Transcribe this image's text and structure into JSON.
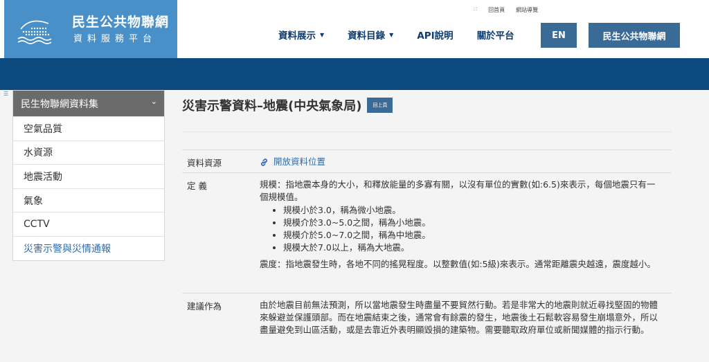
{
  "logo": {
    "title": "民生公共物聯網",
    "subtitle": "資料服務平台"
  },
  "util_nav": {
    "icon": "sitemap-dots-icon",
    "home": "回首頁",
    "sitemap": "網站導覽"
  },
  "main_nav": [
    {
      "label": "資料展示",
      "has_dropdown": true
    },
    {
      "label": "資料目錄",
      "has_dropdown": true
    },
    {
      "label": "API說明",
      "has_dropdown": false
    },
    {
      "label": "關於平台",
      "has_dropdown": false
    }
  ],
  "buttons": {
    "lang": "EN",
    "platform": "民生公共物聯網",
    "back": "回上頁"
  },
  "colors": {
    "logo_bg": "#4a90c8",
    "banner": "#0c4a80",
    "button": "#3a6a96",
    "link": "#2b6cb0",
    "sidebar_head": "#6b6b6b"
  },
  "sidebar": {
    "toggle": "☰",
    "heading": "民生物聯網資料集",
    "items": [
      {
        "label": "空氣品質",
        "active": false
      },
      {
        "label": "水資源",
        "active": false
      },
      {
        "label": "地震活動",
        "active": false
      },
      {
        "label": "氣象",
        "active": false
      },
      {
        "label": "CCTV",
        "active": false
      },
      {
        "label": "災害示警與災情通報",
        "active": true
      }
    ]
  },
  "page": {
    "title": "災害示警資料–地震(中央氣象局)"
  },
  "table": {
    "source": {
      "key": "資料資源",
      "link_label": "開放資料位置",
      "link_icon": "link-icon"
    },
    "definition": {
      "key": "定 義",
      "magnitude_intro": "規模：指地震本身的大小，和釋放能量的多寡有關，以沒有單位的實數(如:6.5)來表示，每個地震只有一個規模值。",
      "bullets": [
        "規模小於3.0，稱為微小地震。",
        "規模介於3.0~5.0之間，稱為小地震。",
        "規模介於5.0~7.0之間，稱為中地震。",
        "規模大於7.0以上，稱為大地震。"
      ],
      "intensity": "震度：指地震發生時，各地不同的搖晃程度。以整數值(如:5級)來表示。通常距離震央越遠，震度越小。"
    },
    "advice": {
      "key": "建議作為",
      "text": "由於地震目前無法預測，所以當地震發生時盡量不要貿然行動。若是非常大的地震則就近尋找堅固的物體來躲避並保護頭部。而在地震結束之後，通常會有餘震的發生，地震後土石鬆軟容易發生崩塌意外，所以盡量避免到山區活動，或是去靠近外表明顯毀損的建築物。需要聽取政府單位或新聞媒體的指示行動。"
    }
  }
}
